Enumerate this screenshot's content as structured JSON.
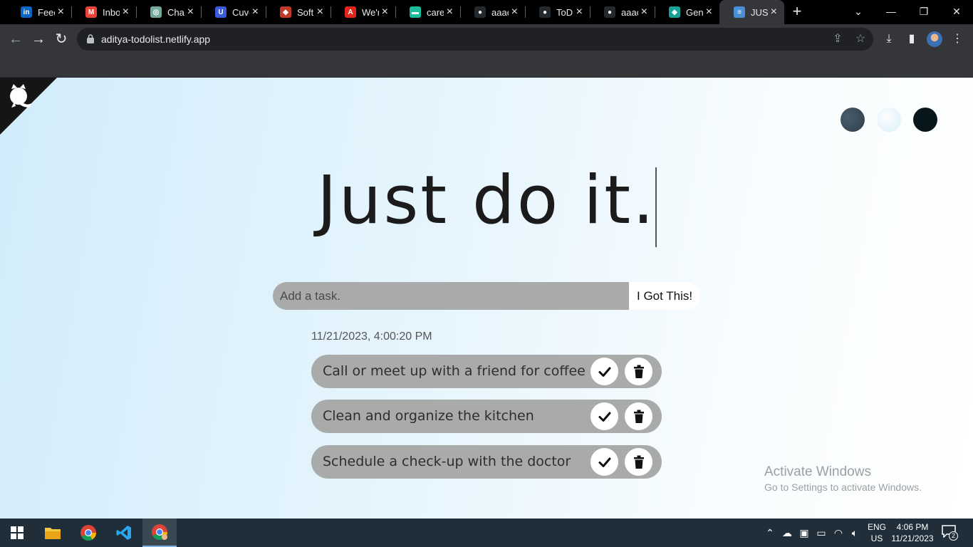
{
  "browser": {
    "tabs": [
      {
        "label": "Feed",
        "icon": "linkedin-icon",
        "color": "#0a66c2",
        "glyph": "in"
      },
      {
        "label": "Inbox",
        "icon": "gmail-icon",
        "color": "#ea4335",
        "glyph": "M"
      },
      {
        "label": "Chat",
        "icon": "chatgpt-icon",
        "color": "#74aa9c",
        "glyph": "◎"
      },
      {
        "label": "Cuve",
        "icon": "cuvette-icon",
        "color": "#3b5bdb",
        "glyph": "U"
      },
      {
        "label": "Soft",
        "icon": "softwarecompany-icon",
        "color": "#c0392b",
        "glyph": "◆"
      },
      {
        "label": "We'r",
        "icon": "adobe-icon",
        "color": "#e1251b",
        "glyph": "A"
      },
      {
        "label": "care",
        "icon": "careers-icon",
        "color": "#1abc9c",
        "glyph": "▬"
      },
      {
        "label": "aaac",
        "icon": "github-icon",
        "color": "#24292e",
        "glyph": "●"
      },
      {
        "label": "ToD",
        "icon": "github-icon",
        "color": "#24292e",
        "glyph": "●"
      },
      {
        "label": "aaac",
        "icon": "github-icon",
        "color": "#24292e",
        "glyph": "●"
      },
      {
        "label": "Gen",
        "icon": "gemini-icon",
        "color": "#14a396",
        "glyph": "◆"
      },
      {
        "label": "JUST",
        "icon": "list-icon",
        "color": "#4a90d9",
        "glyph": "≡",
        "active": true
      }
    ],
    "url": "aditya-todolist.netlify.app"
  },
  "app": {
    "heading": "Just do it.",
    "theme_colors": [
      "#2c3e4a",
      "#e8f7fd",
      "#06161b"
    ],
    "input_placeholder": "Add a task.",
    "add_button": "I Got This!",
    "timestamp": "11/21/2023, 4:00:20 PM",
    "todos": [
      {
        "text": "Call or meet up with a friend for coffee"
      },
      {
        "text": "Clean and organize the kitchen"
      },
      {
        "text": "Schedule a check-up with the doctor"
      }
    ],
    "watermark": {
      "title": "Activate Windows",
      "subtitle": "Go to Settings to activate Windows."
    }
  },
  "taskbar": {
    "lang_top": "ENG",
    "lang_bottom": "US",
    "time": "4:06 PM",
    "date": "11/21/2023",
    "notification_count": "2"
  }
}
